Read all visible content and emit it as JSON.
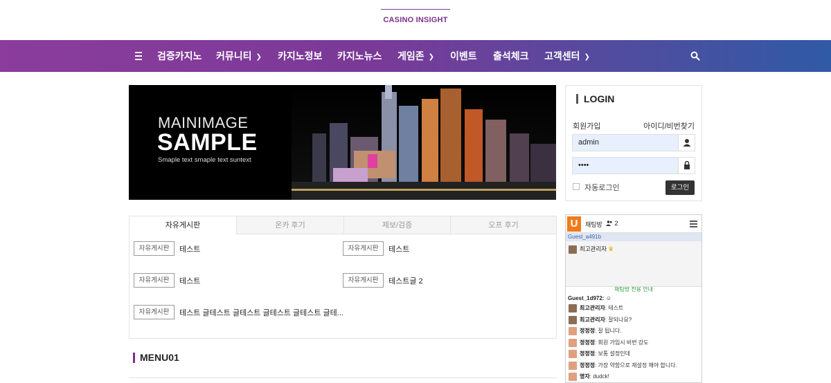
{
  "header": {
    "logo": "CASINO INSIGHT"
  },
  "nav": {
    "items": [
      {
        "label": "검증카지노",
        "has_dropdown": false
      },
      {
        "label": "커뮤니티",
        "has_dropdown": true
      },
      {
        "label": "카지노정보",
        "has_dropdown": false
      },
      {
        "label": "카지노뉴스",
        "has_dropdown": false
      },
      {
        "label": "게임존",
        "has_dropdown": true
      },
      {
        "label": "이벤트",
        "has_dropdown": false
      },
      {
        "label": "출석체크",
        "has_dropdown": false
      },
      {
        "label": "고객센터",
        "has_dropdown": true
      }
    ],
    "menu_icon": "hamburger-icon",
    "search_icon": "search-icon",
    "gradient_colors": [
      "#8b3c9c",
      "#2f5aa6"
    ]
  },
  "banner": {
    "line1": "MAINIMAGE",
    "line2": "SAMPLE",
    "subtext": "Smaple text smaple text suntext"
  },
  "login": {
    "title": "LOGIN",
    "signup_link": "회원가입",
    "find_link": "아이디/비번찾기",
    "username_value": "admin",
    "password_value": "••••",
    "auto_login_label": "자동로그인",
    "submit_label": "로그인"
  },
  "board": {
    "tabs": [
      {
        "label": "자유게시판",
        "active": true
      },
      {
        "label": "온카 후기",
        "active": false
      },
      {
        "label": "제보/검증",
        "active": false
      },
      {
        "label": "오프 후기",
        "active": false
      }
    ],
    "posts": [
      {
        "badge": "자유게시판",
        "title": "테스트"
      },
      {
        "badge": "자유게시판",
        "title": "테스트"
      },
      {
        "badge": "자유게시판",
        "title": "테스트"
      },
      {
        "badge": "자유게시판",
        "title": "테스트글 2"
      },
      {
        "badge": "자유게시판",
        "title": "테스트 글테스트 글테스트 글테스트 글테스트 글테..."
      }
    ]
  },
  "menu01": {
    "title": "MENU01"
  },
  "chat": {
    "logo_letter": "U",
    "title": "채팅방",
    "user_count": "2",
    "guest_top": "Guest_a491b",
    "admin_user": "최고관리자",
    "notice": "채팅방 전용 안내",
    "guest2": "Guest_1d972: ☺",
    "messages": [
      {
        "name": "최고관리자",
        "text": "테스트",
        "avatar": "admin"
      },
      {
        "name": "최고관리자",
        "text": "잘되나요?",
        "avatar": "admin"
      },
      {
        "name": "정정정",
        "text": "잘 됩니다.",
        "avatar": "user"
      },
      {
        "name": "정정정",
        "text": "회원 가입시 비번 강도",
        "avatar": "user"
      },
      {
        "name": "정정정",
        "text": "보통 설정인데",
        "avatar": "user"
      },
      {
        "name": "정정정",
        "text": "가장 약함으로 재설정 해야 합니다.",
        "avatar": "user"
      },
      {
        "name": "명자",
        "text": "dudck!",
        "avatar": "user"
      }
    ]
  }
}
